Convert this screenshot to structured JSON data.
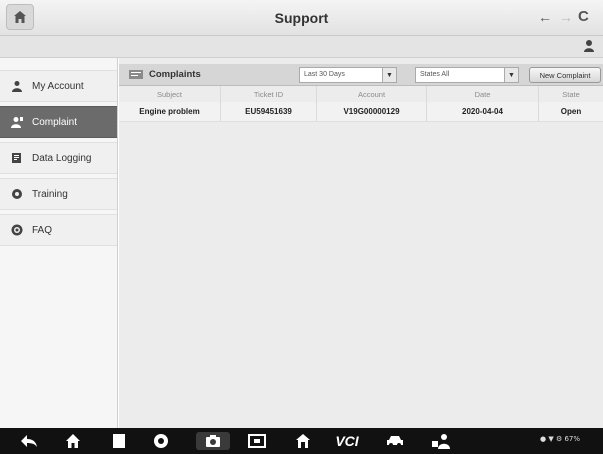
{
  "header": {
    "title": "Support",
    "back_icon": "arrow-left-icon",
    "forward_icon": "arrow-right-icon",
    "refresh_label": "C"
  },
  "sidebar": {
    "items": [
      {
        "label": "My Account",
        "icon": "user-icon",
        "active": false
      },
      {
        "label": "Complaint",
        "icon": "complaint-icon",
        "active": true
      },
      {
        "label": "Data Logging",
        "icon": "data-logging-icon",
        "active": false
      },
      {
        "label": "Training",
        "icon": "training-icon",
        "active": false
      },
      {
        "label": "FAQ",
        "icon": "faq-icon",
        "active": false
      }
    ]
  },
  "main": {
    "toolbar": {
      "title": "Complaints",
      "period_select": "Last 30 Days",
      "state_select": "States All",
      "new_button": "New Complaint"
    },
    "table": {
      "columns": [
        "Subject",
        "Ticket ID",
        "Account",
        "Date",
        "State"
      ],
      "rows": [
        [
          "Engine problem",
          "EU59451639",
          "V19G00000129",
          "2020-04-04",
          "Open"
        ]
      ]
    }
  },
  "system_bar": {
    "icons": [
      "back-icon",
      "home-icon",
      "recent-apps-icon",
      "browser-icon",
      "camera-icon",
      "screen-record-icon",
      "autel-home-icon",
      "vci-icon",
      "car-icon",
      "remote-icon"
    ],
    "vci_label": "VCI",
    "status": "67%"
  },
  "colors": {
    "sidebar_active": "#6b6b6b",
    "system_bar": "#111111",
    "toolbar": "#d6d6d6"
  }
}
